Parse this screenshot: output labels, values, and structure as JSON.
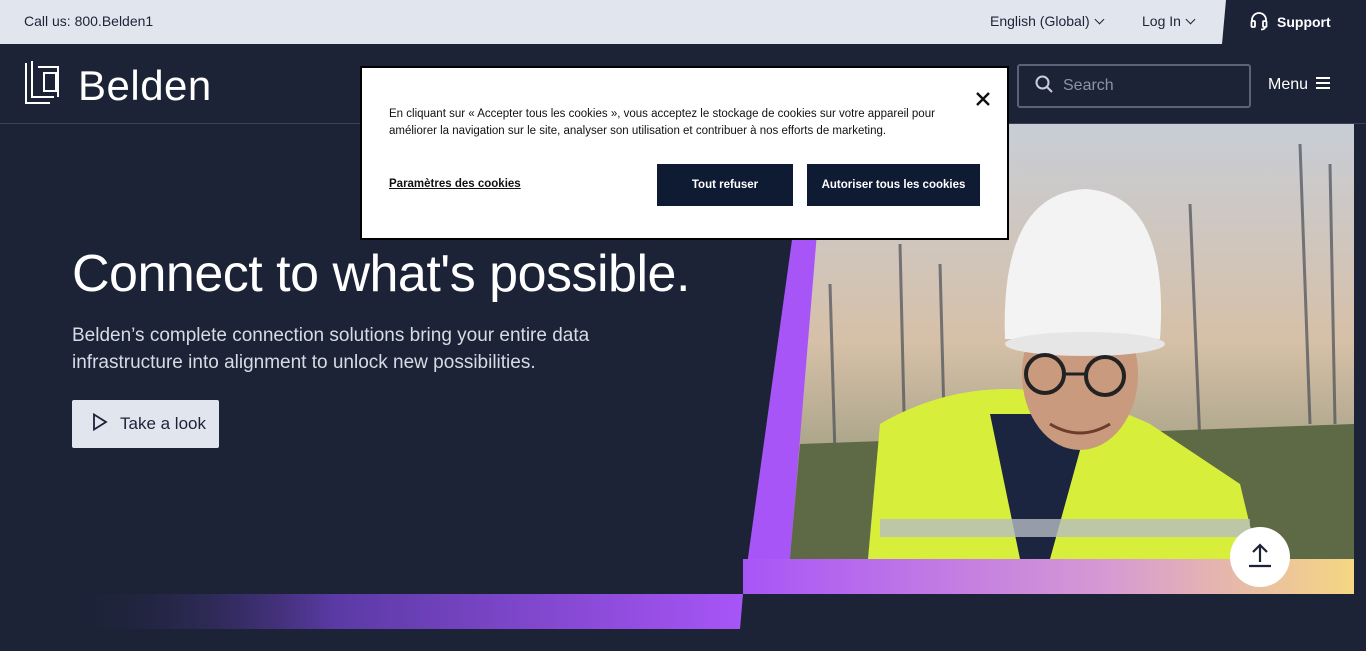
{
  "topbar": {
    "call": "Call us: 800.Belden1",
    "language": "English (Global)",
    "login": "Log In",
    "support": "Support"
  },
  "nav": {
    "logo_text": "Belden",
    "search_placeholder": "Search",
    "menu": "Menu"
  },
  "hero": {
    "headline": "Connect to what's possible.",
    "subtext": "Belden’s complete connection solutions bring your entire data infrastructure into alignment to unlock new possibilities.",
    "cta": "Take a look"
  },
  "cookie_banner": {
    "text": "En cliquant sur « Accepter tous les cookies », vous acceptez le stockage de cookies sur votre appareil pour améliorer la navigation sur le site, analyser son utilisation et contribuer à nos efforts de marketing.",
    "settings_link": "Paramètres des cookies",
    "refuse_button": "Tout refuser",
    "accept_button": "Autoriser tous les cookies"
  },
  "colors": {
    "navy": "#1c2337",
    "light_bar": "#e1e6ee",
    "purple": "#a855f7",
    "button_dark": "#0f1a33"
  },
  "icons": [
    "headset-icon",
    "chevron-down-icon",
    "search-icon",
    "hamburger-icon",
    "play-icon",
    "arrow-up-icon",
    "close-icon",
    "belden-logo-icon"
  ]
}
